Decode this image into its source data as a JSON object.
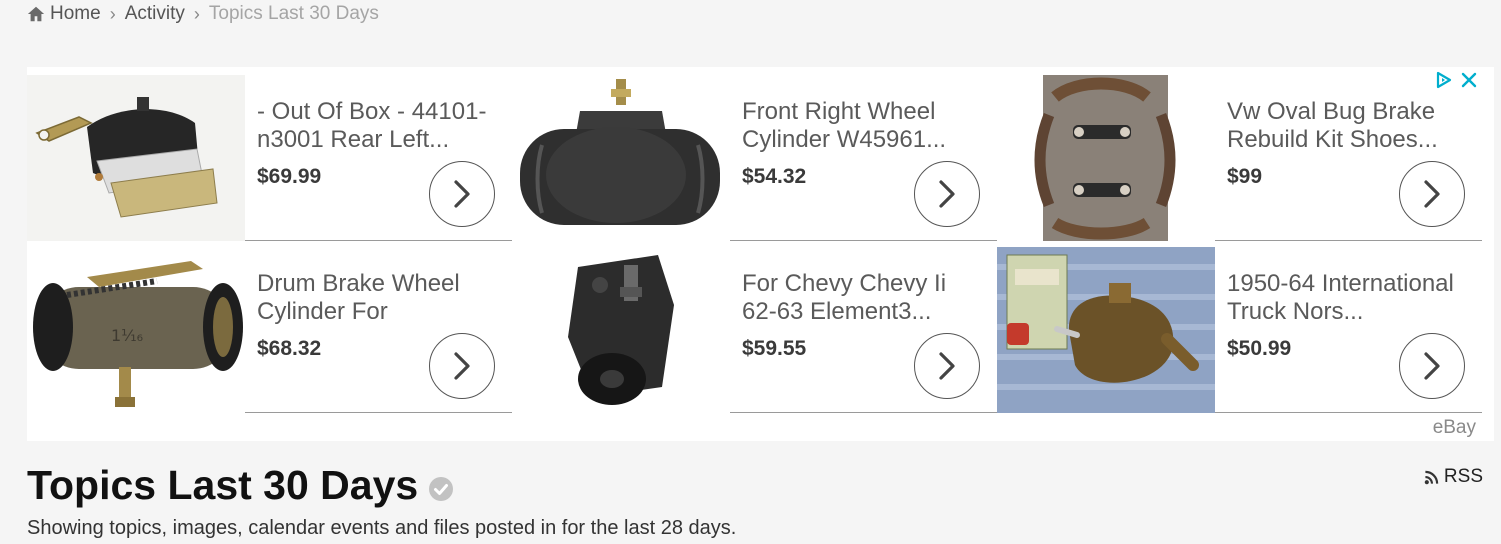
{
  "breadcrumb": {
    "home": "Home",
    "activity": "Activity",
    "current": "Topics Last 30 Days"
  },
  "ad": {
    "attribution": "eBay",
    "products": [
      {
        "title": "- Out Of Box - 44101-\nn3001 Rear Left...",
        "price": "$69.99",
        "image": "wheel-cylinder-bracket-image"
      },
      {
        "title": "Front Right Wheel\nCylinder W45961...",
        "price": "$54.32",
        "image": "wheel-cylinder-image"
      },
      {
        "title": "Vw Oval Bug Brake\nRebuild Kit Shoes...",
        "price": "$99",
        "image": "brake-shoes-kit-image"
      },
      {
        "title": "Drum Brake Wheel\nCylinder For",
        "price": "$68.32",
        "image": "drum-brake-cylinder-image"
      },
      {
        "title": "For Chevy Chevy Ii\n62-63 Element3...",
        "price": "$59.55",
        "image": "chevy-wheel-cylinder-image"
      },
      {
        "title": "1950-64 International\nTruck Nors...",
        "price": "$50.99",
        "image": "nors-cylinder-box-image"
      }
    ]
  },
  "page": {
    "title": "Topics Last 30 Days",
    "rss": "RSS",
    "description": "Showing topics, images, calendar events and files posted in for the last 28 days."
  },
  "colors": {
    "background": "#f5f5f5",
    "ad_background": "#ffffff",
    "ad_choices": "#00aecd",
    "title_text": "#111111",
    "price_text": "#3a3a3a"
  }
}
